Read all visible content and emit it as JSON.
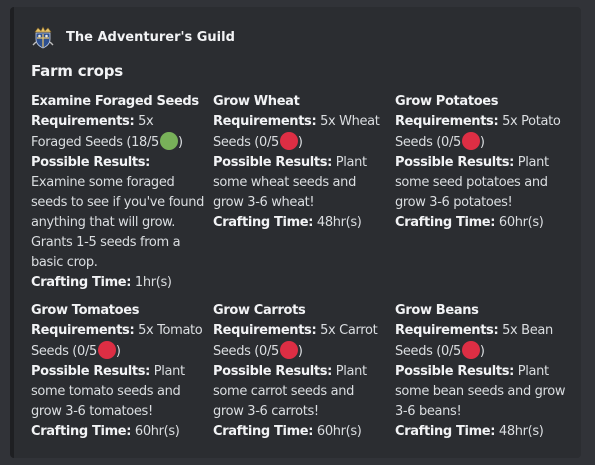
{
  "author": {
    "name": "The Adventurer's Guild",
    "icon": "guild-crest-icon"
  },
  "title": "Farm crops",
  "labels": {
    "requirements": "Requirements:",
    "possible_results": "Possible Results:",
    "crafting_time": "Crafting Time:"
  },
  "colors": {
    "red": "#dd2e44",
    "green": "#78b159"
  },
  "fields": [
    {
      "name": "Examine Foraged Seeds",
      "req_before": "5x Foraged Seeds (18/5",
      "req_status": "green",
      "req_after": ")",
      "results": "Examine some foraged seeds to see if you've found anything that will grow. Grants 1-5 seeds from a basic crop.",
      "time": "1hr(s)"
    },
    {
      "name": "Grow Wheat",
      "req_before": "5x Wheat Seeds (0/5",
      "req_status": "red",
      "req_after": ")",
      "results": "Plant some wheat seeds and grow 3-6 wheat!",
      "time": "48hr(s)"
    },
    {
      "name": "Grow Potatoes",
      "req_before": "5x Potato Seeds (0/5",
      "req_status": "red",
      "req_after": ")",
      "results": "Plant some seed potatoes and grow 3-6 potatoes!",
      "time": "60hr(s)"
    },
    {
      "name": "Grow Tomatoes",
      "req_before": "5x Tomato Seeds (0/5",
      "req_status": "red",
      "req_after": ")",
      "results": "Plant some tomato seeds and grow 3-6 tomatoes!",
      "time": "60hr(s)"
    },
    {
      "name": "Grow Carrots",
      "req_before": "5x Carrot Seeds (0/5",
      "req_status": "red",
      "req_after": ")",
      "results": "Plant some carrot seeds and grow 3-6 carrots!",
      "time": "60hr(s)"
    },
    {
      "name": "Grow Beans",
      "req_before": "5x Bean Seeds (0/5",
      "req_status": "red",
      "req_after": ")",
      "results": "Plant some bean seeds and grow 3-6 beans!",
      "time": "48hr(s)"
    }
  ]
}
